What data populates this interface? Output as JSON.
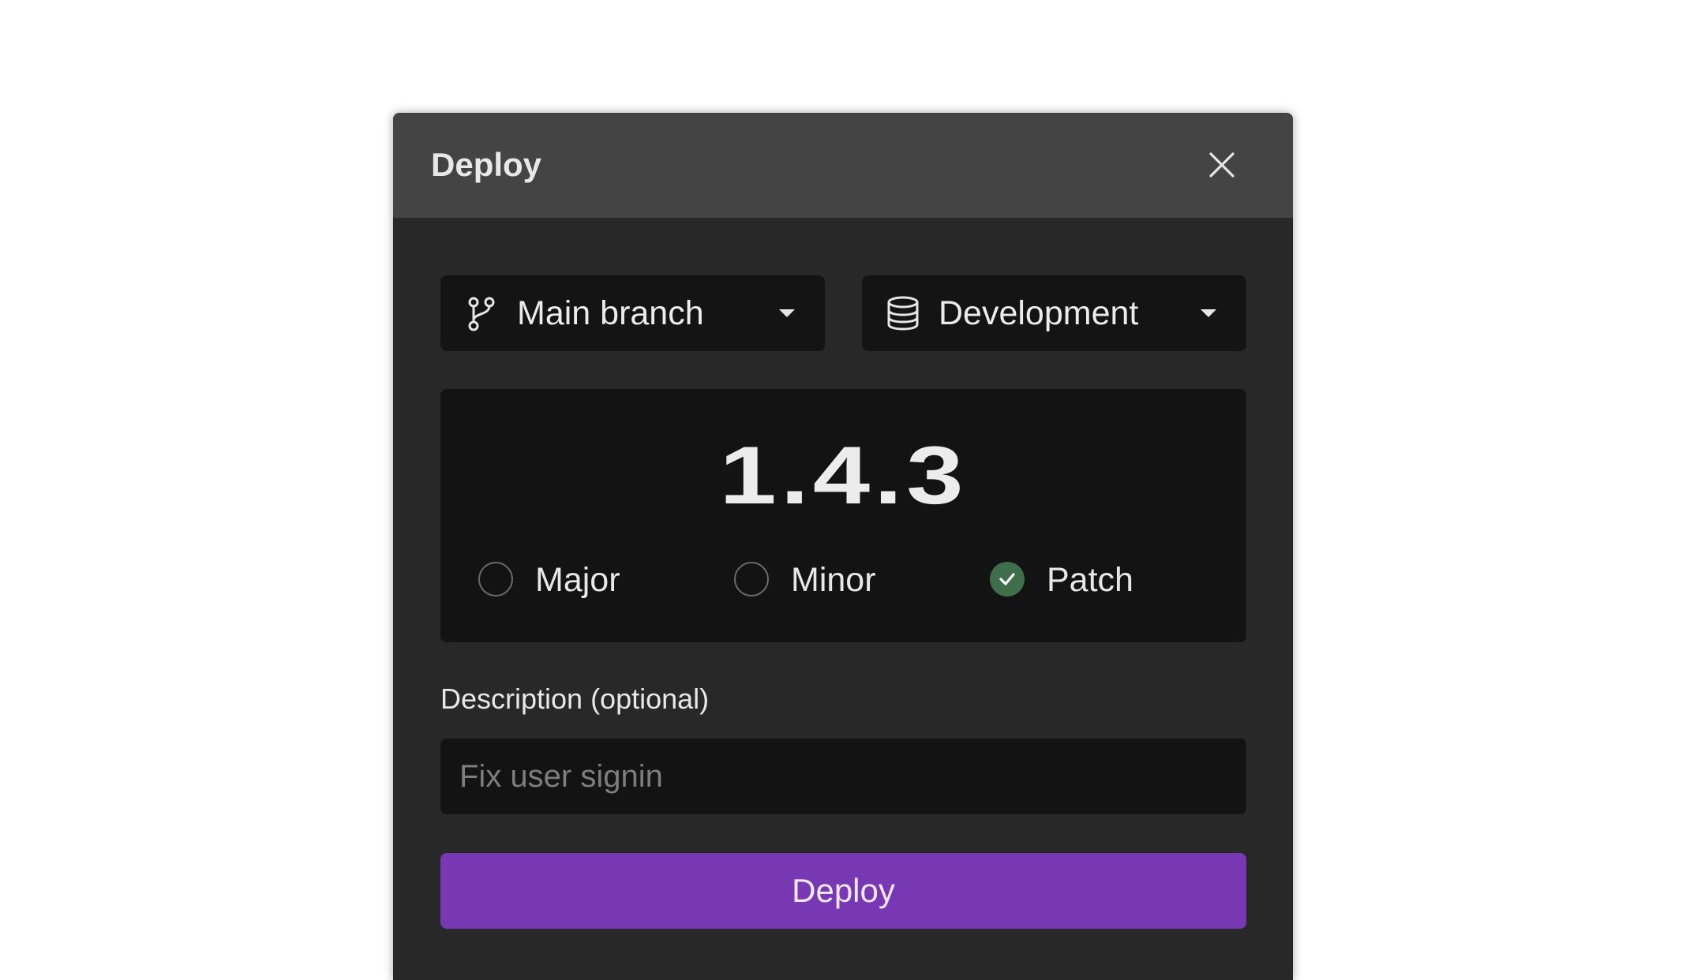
{
  "dialog": {
    "title": "Deploy"
  },
  "branch_select": {
    "icon": "git-branch-icon",
    "value": "Main branch"
  },
  "environment_select": {
    "icon": "database-icon",
    "value": "Development"
  },
  "version": {
    "number": "1.4.3",
    "options": [
      {
        "label": "Major",
        "checked": false
      },
      {
        "label": "Minor",
        "checked": false
      },
      {
        "label": "Patch",
        "checked": true
      }
    ]
  },
  "description": {
    "label": "Description (optional)",
    "placeholder": "Fix user signin",
    "value": ""
  },
  "deploy_button": {
    "label": "Deploy"
  },
  "colors": {
    "accent": "#7837b3",
    "check": "#3f6e4b",
    "header": "#444444",
    "panel": "#282828",
    "field": "#131313"
  }
}
